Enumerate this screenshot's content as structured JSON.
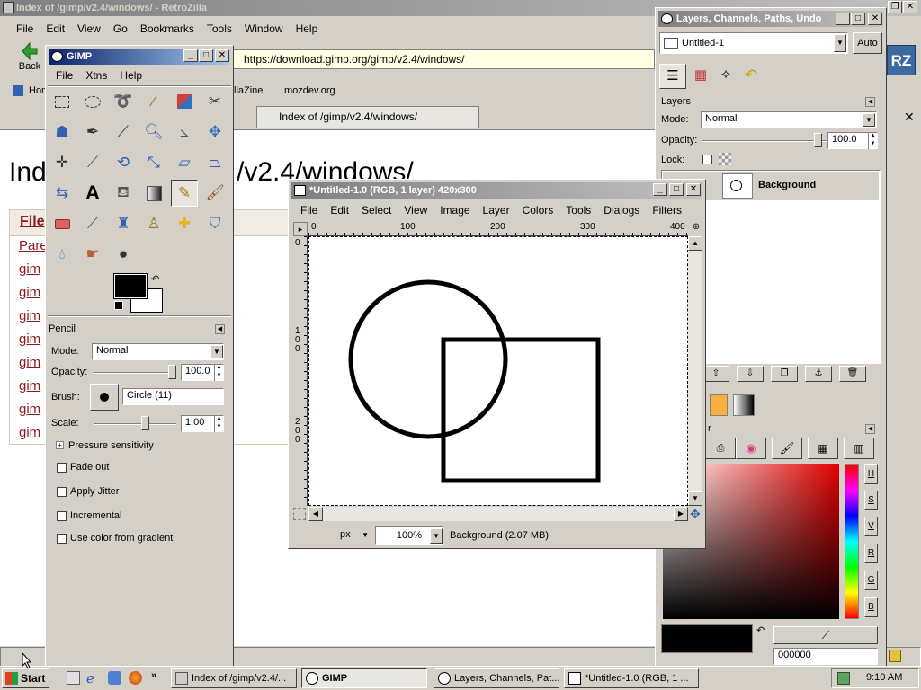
{
  "browser": {
    "window_title": "Index of /gimp/v2.4/windows/ - RetroZilla",
    "menu": [
      "File",
      "Edit",
      "View",
      "Go",
      "Bookmarks",
      "Tools",
      "Window",
      "Help"
    ],
    "back_label": "Back",
    "url": "https://download.gimp.org/gimp/v2.4/windows/",
    "logo": "RZ",
    "bookmarks": [
      "Hom",
      "llaZine",
      "mozdev.org"
    ],
    "tab_title": "Index of /gimp/v2.4/windows/",
    "page_heading": "Index of /gimp/v2.4/windows/",
    "page_heading_visible": "/v2.4/windows/",
    "page_heading_left": "Ind",
    "column_header": "File",
    "links": [
      "Pare",
      "gim",
      "gim",
      "gim",
      "gim",
      "gim",
      "gim",
      "gim",
      "gim"
    ]
  },
  "toolbox": {
    "title": "GIMP",
    "menu": [
      "File",
      "Xtns",
      "Help"
    ],
    "tool_options_title": "Pencil",
    "mode_label": "Mode:",
    "mode_value": "Normal",
    "opacity_label": "Opacity:",
    "opacity_value": "100.0",
    "brush_label": "Brush:",
    "brush_value": "Circle (11)",
    "scale_label": "Scale:",
    "scale_value": "1.00",
    "pressure_label": "Pressure sensitivity",
    "options": [
      "Fade out",
      "Apply Jitter",
      "Incremental",
      "Use color from gradient"
    ],
    "fg_color": "#000000",
    "bg_color": "#ffffff"
  },
  "image_window": {
    "title": "*Untitled-1.0 (RGB, 1 layer) 420x300",
    "menu": [
      "File",
      "Edit",
      "Select",
      "View",
      "Image",
      "Layer",
      "Colors",
      "Tools",
      "Dialogs",
      "Filters"
    ],
    "ruler_h": [
      "0",
      "100",
      "200",
      "300",
      "400"
    ],
    "ruler_v": [
      "0",
      "100",
      "200"
    ],
    "unit": "px",
    "zoom": "100%",
    "status": "Background (2.07 MB)"
  },
  "layers_dock": {
    "title": "Layers, Channels, Paths, Undo",
    "image_select": "Untitled-1",
    "auto_label": "Auto",
    "section_title": "Layers",
    "mode_label": "Mode:",
    "mode_value": "Normal",
    "opacity_label": "Opacity:",
    "opacity_value": "100.0",
    "lock_label": "Lock:",
    "layer_name": "Background",
    "fg_section_title": "r",
    "channels": [
      "H",
      "S",
      "V",
      "R",
      "G",
      "B"
    ],
    "hex_value": "000000"
  },
  "taskbar": {
    "start_label": "Start",
    "tasks": [
      "Index of /gimp/v2.4/...",
      "GIMP",
      "Layers, Channels, Pat...",
      "*Untitled-1.0 (RGB, 1 ..."
    ],
    "clock": "9:10 AM"
  },
  "colors": {
    "titlebar_active": "#0a246a",
    "link": "#8b1a1a",
    "desktop": "#d4d0c8"
  }
}
